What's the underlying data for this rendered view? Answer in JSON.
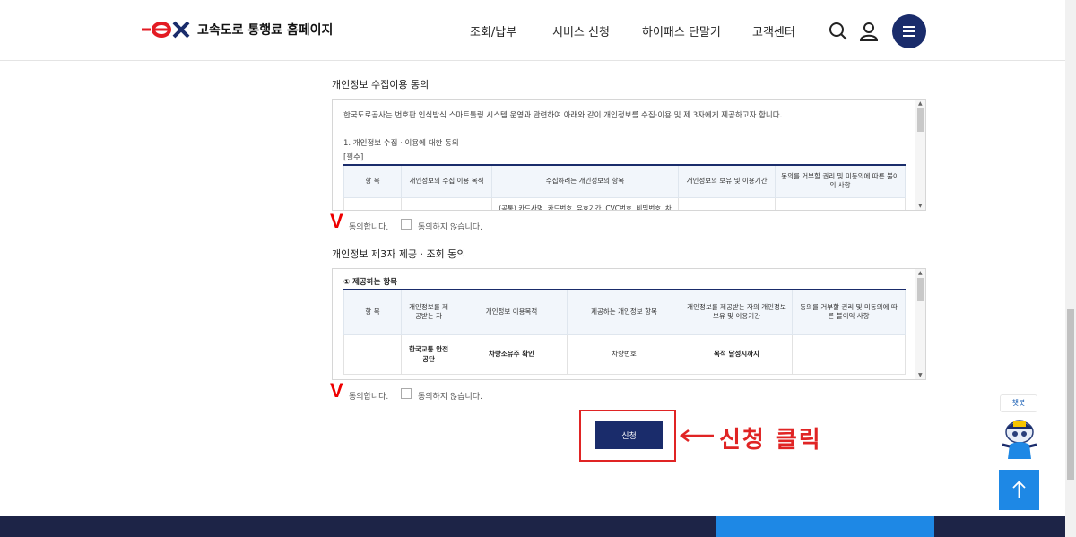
{
  "header": {
    "logo_mark": "ex",
    "logo_text": "고속도로 통행료 홈페이지",
    "nav": [
      "조회/납부",
      "서비스 신청",
      "하이패스 단말기",
      "고객센터"
    ],
    "icons": {
      "search": "search-icon",
      "user": "user-icon",
      "menu": "hamburger-menu-icon"
    },
    "brand_color": "#1a2c6b",
    "logo_color": "#e31b23"
  },
  "section1": {
    "title": "개인정보 수집이용 동의",
    "intro": "한국도로공사는 번호판 인식방식 스마트톨링 시스템 운영과 관련하여 아래와 같이 개인정보를 수집·이용 및 제 3자에게 제공하고자 합니다.",
    "item_heading": "1. 개인정보 수집 · 이용에 대한 동의",
    "required": "[필수]",
    "table": {
      "headers": [
        "항 목",
        "개인정보의 수집·이용 목적",
        "수집하려는 개인정보의 항목",
        "개인정보의 보유 및 이용기간",
        "동의를 거부할 권리 및 미동의에 따른 불이익 사항"
      ],
      "row_partial": "(공통) 카드사명, 카드번호, 유효기간, CVC번호, 비밀번호, 차"
    },
    "consent": {
      "mark": "V",
      "agree": "동의합니다.",
      "disagree": "동의하지 않습니다."
    }
  },
  "section2": {
    "title": "개인정보 제3자 제공 · 조회 동의",
    "item_heading": "① 제공하는 항목",
    "table": {
      "headers": [
        "항 목",
        "개인정보를 제공받는 자",
        "개인정보 이용목적",
        "제공하는 개인정보 항목",
        "개인정보를 제공받는 자의 개인정보 보유 및 이용기간",
        "동의를 거부할 권리 및 미동의에 따른 불이익 사항"
      ],
      "row": [
        "",
        "한국교통 안전공단",
        "차량소유주 확인",
        "차량번호",
        "목적 달성시까지",
        ""
      ]
    },
    "consent": {
      "mark": "V",
      "agree": "동의합니다.",
      "disagree": "동의하지 않습니다."
    }
  },
  "apply_button": {
    "label": "신청"
  },
  "annotation": {
    "text": "신청 클릭",
    "color": "#e02424"
  },
  "floating": {
    "chatbot_label": "챗봇",
    "top_button": "scroll-top-icon",
    "accent": "#1e88e5"
  },
  "footer": {
    "text": ""
  }
}
